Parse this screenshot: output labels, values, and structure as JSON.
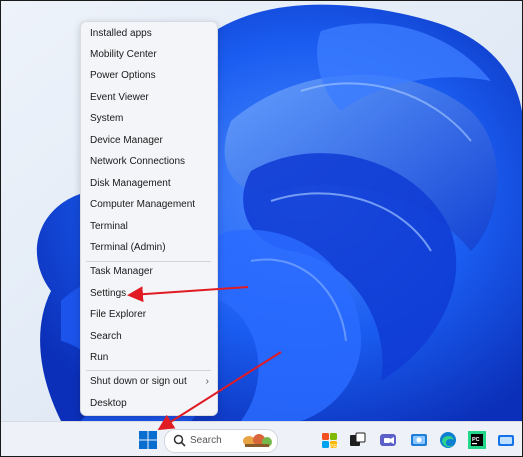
{
  "context_menu": {
    "items": [
      {
        "label": "Installed apps"
      },
      {
        "label": "Mobility Center"
      },
      {
        "label": "Power Options"
      },
      {
        "label": "Event Viewer"
      },
      {
        "label": "System"
      },
      {
        "label": "Device Manager"
      },
      {
        "label": "Network Connections"
      },
      {
        "label": "Disk Management"
      },
      {
        "label": "Computer Management"
      },
      {
        "label": "Terminal"
      },
      {
        "label": "Terminal (Admin)"
      },
      {
        "label": "Task Manager"
      },
      {
        "label": "Settings"
      },
      {
        "label": "File Explorer"
      },
      {
        "label": "Search"
      },
      {
        "label": "Run"
      },
      {
        "label": "Shut down or sign out",
        "has_submenu": true,
        "chevron": "›"
      },
      {
        "label": "Desktop"
      }
    ]
  },
  "taskbar": {
    "search_label": "Search",
    "icons": [
      "windows-start-icon",
      "search-icon",
      "widgets-icon",
      "app-icon-1",
      "task-view-icon",
      "chat-icon",
      "app-icon-2",
      "edge-icon",
      "terminal-icon",
      "app-icon-3"
    ]
  },
  "colors": {
    "wallpaper_base": "#e4ecf6",
    "bloom_blue": "#1a5cf0",
    "bloom_dark": "#0b2fb8",
    "annotation_red": "#e01b24",
    "start_blue": "#0a6ed1"
  }
}
